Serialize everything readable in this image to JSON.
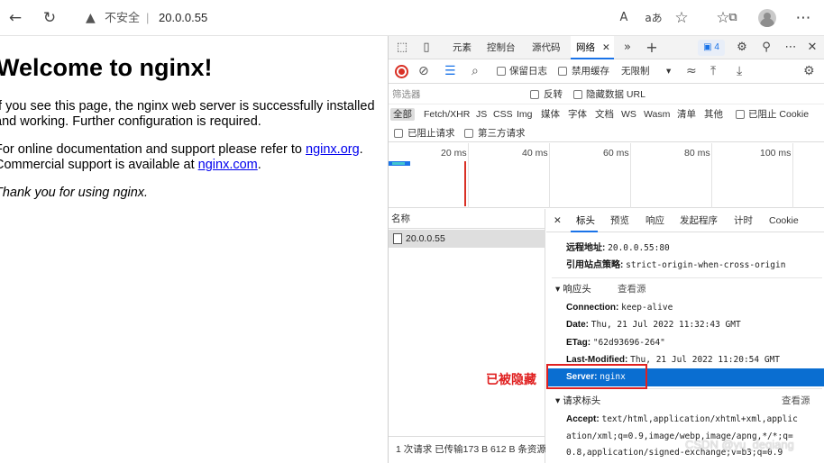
{
  "browser": {
    "security_label": "不安全",
    "separator": "|",
    "url": "20.0.0.55"
  },
  "page": {
    "heading": "Welcome to nginx!",
    "para1": "If you see this page, the nginx web server is successfully installed and working. Further configuration is required.",
    "para2_prefix": "For online documentation and support please refer to ",
    "para2_link1": "nginx.org",
    "para2_mid": ". Commercial support is available at ",
    "para2_link2": "nginx.com",
    "para2_suffix": ".",
    "para3": "Thank you for using nginx."
  },
  "devtools": {
    "tabs": [
      "元素",
      "控制台",
      "源代码",
      "网络"
    ],
    "active_tab": "网络",
    "issues_count": "4",
    "toolbar": {
      "preserve_log": "保留日志",
      "disable_cache": "禁用缓存",
      "throttle": "无限制"
    },
    "filter": {
      "placeholder": "筛选器",
      "invert": "反转",
      "hide_data_urls": "隐藏数据 URL"
    },
    "types": [
      "全部",
      "Fetch/XHR",
      "JS",
      "CSS",
      "Img",
      "媒体",
      "字体",
      "文档",
      "WS",
      "Wasm",
      "清单",
      "其他"
    ],
    "blocked_cookies": "已阻止 Cookie",
    "blocked_requests": "已阻止请求",
    "third_party": "第三方请求",
    "timeline_labels": [
      "20 ms",
      "40 ms",
      "60 ms",
      "80 ms",
      "100 ms"
    ],
    "request_list": {
      "header": "名称",
      "row": "20.0.0.55",
      "status": "1 次请求  已传输173 B  612 B 条资源"
    },
    "detail_tabs": [
      "标头",
      "预览",
      "响应",
      "发起程序",
      "计时",
      "Cookie"
    ],
    "general": {
      "remote_key": "远程地址:",
      "remote_val": "20.0.0.55:80",
      "referrer_key": "引用站点策略:",
      "referrer_val": "strict-origin-when-cross-origin"
    },
    "response_headers": {
      "title": "▾ 响应头",
      "view_source": "查看源",
      "connection_key": "Connection:",
      "connection_val": "keep-alive",
      "date_key": "Date:",
      "date_val": "Thu, 21 Jul 2022 11:32:43 GMT",
      "etag_key": "ETag:",
      "etag_val": "\"62d93696-264\"",
      "lm_key": "Last-Modified:",
      "lm_val": "Thu, 21 Jul 2022 11:20:54 GMT",
      "server_key": "Server:",
      "server_val": "nginx"
    },
    "request_headers": {
      "title": "▾ 请求标头",
      "view_source": "查看源",
      "accept_key": "Accept:",
      "accept_line1": "text/html,application/xhtml+xml,applic",
      "accept_line2": "ation/xml;q=0.9,image/webp,image/apng,*/*;q=",
      "accept_line3": "0.8,application/signed-exchange;v=b3;q=0.9"
    }
  },
  "annotation": {
    "hidden_label": "已被隐藏",
    "color": "#e02020"
  },
  "watermark": "CSDN @yu_deqiang"
}
